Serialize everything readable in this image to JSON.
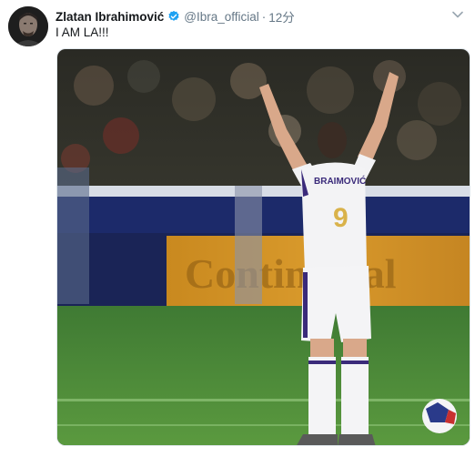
{
  "tweet": {
    "author_name": "Zlatan Ibrahimović",
    "handle": "@Ibra_official",
    "separator": "·",
    "time": "12分",
    "text": "I AM LA!!!",
    "verified_icon": "verified-badge-icon",
    "menu_icon": "chevron-down-icon"
  },
  "media": {
    "banner_text": "Continental",
    "jersey_name": "BRAIMOVIĆ",
    "jersey_number": "9"
  },
  "colors": {
    "verified_blue": "#1da1f2",
    "muted_text": "#657786"
  }
}
